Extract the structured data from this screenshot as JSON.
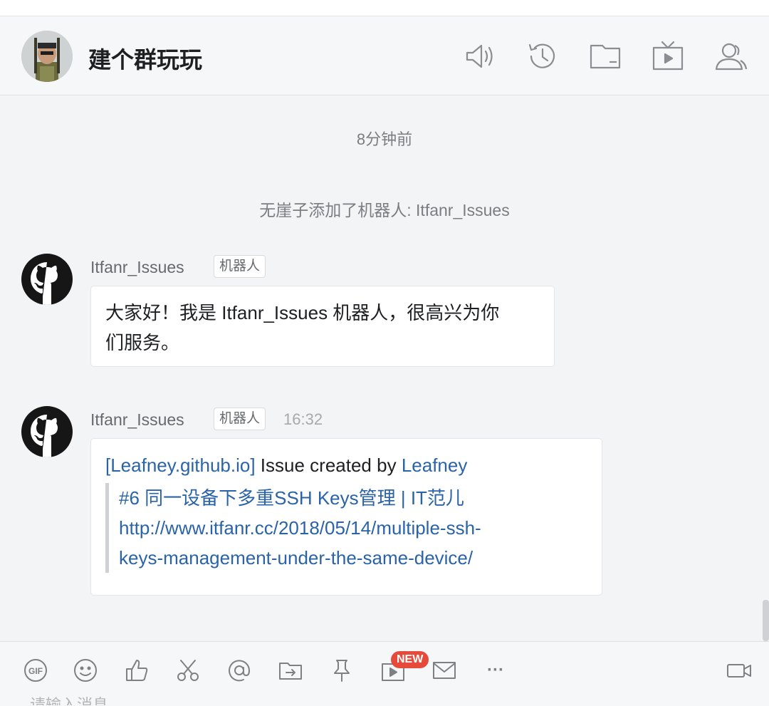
{
  "header": {
    "group_name": "建个群玩玩",
    "icons": [
      "speaker-icon",
      "history-icon",
      "folder-icon",
      "tv-icon",
      "members-icon"
    ]
  },
  "chat": {
    "timestamp": "8分钟前",
    "system_message": "无崖子添加了机器人: Itfanr_Issues",
    "messages": [
      {
        "sender": "Itfanr_Issues",
        "badge": "机器人",
        "time": "",
        "text_line1": "大家好！我是 Itfanr_Issues 机器人，很高兴为你",
        "text_line2": "们服务。"
      },
      {
        "sender": "Itfanr_Issues",
        "badge": "机器人",
        "time": "16:32",
        "repo_link": "[Leafney.github.io]",
        "issue_text": " Issue created by ",
        "author_link": "Leafney",
        "issue_title": "#6 同一设备下多重SSH Keys管理 | IT范儿",
        "issue_url_line1": "http://www.itfanr.cc/2018/05/14/multiple-ssh-",
        "issue_url_line2": "keys-management-under-the-same-device/"
      }
    ]
  },
  "toolbar": {
    "new_badge": "NEW",
    "gif_label": "GIF",
    "more_label": "···",
    "input_placeholder": "请输入消息"
  },
  "colors": {
    "link": "#2a63a8",
    "new_badge": "#e64a3b"
  }
}
